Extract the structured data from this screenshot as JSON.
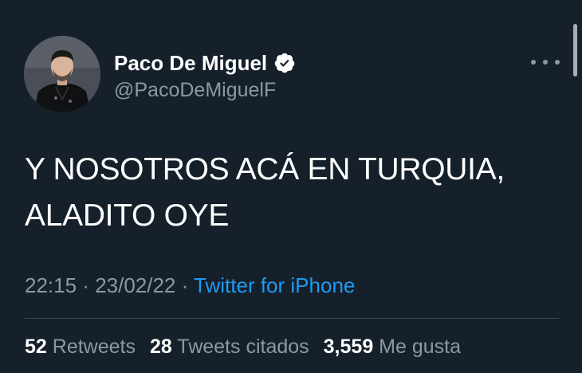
{
  "user": {
    "display_name": "Paco De Miguel",
    "handle": "@PacoDeMiguelF",
    "verified": true
  },
  "tweet": {
    "lines": [
      "Y NOSOTROS ACÁ EN TURQUIA,",
      "ALADITO OYE"
    ]
  },
  "meta": {
    "time": "22:15",
    "sep1": " · ",
    "date": "23/02/22",
    "sep2": " · ",
    "source": "Twitter for iPhone"
  },
  "stats": [
    {
      "count": "52",
      "label": "Retweets"
    },
    {
      "count": "28",
      "label": "Tweets citados"
    },
    {
      "count": "3,559",
      "label": "Me gusta"
    }
  ],
  "colors": {
    "background": "#15202b",
    "text": "#ffffff",
    "muted": "#8b98a5",
    "link": "#1d9bf0",
    "divider": "#38444d"
  },
  "icons": {
    "verified": "verified-badge-icon",
    "more": "more-options-icon"
  }
}
